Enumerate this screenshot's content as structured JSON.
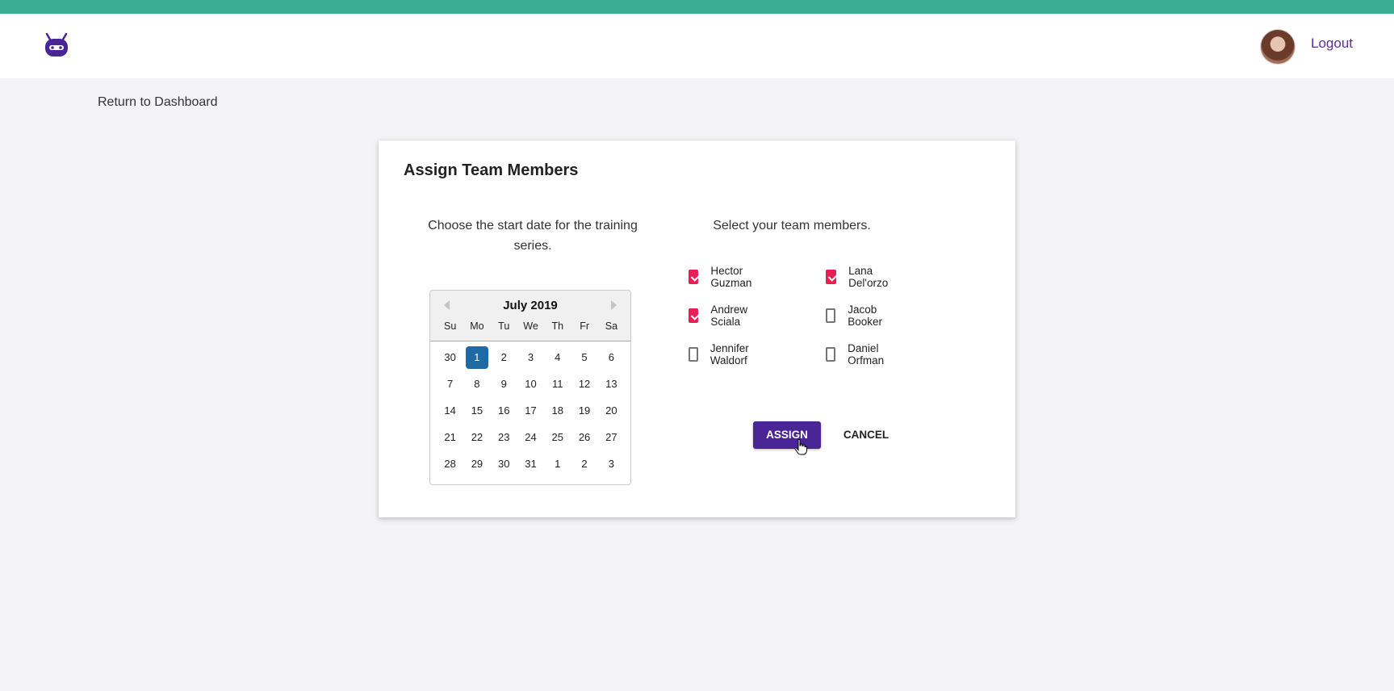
{
  "header": {
    "logo_icon": "robot-logo-icon",
    "avatar_icon": "user-avatar-icon",
    "logout_label": "Logout"
  },
  "nav": {
    "return_label": "Return to Dashboard"
  },
  "dialog": {
    "title": "Assign Team Members",
    "date_instruction": "Choose the start date for the training series.",
    "members_instruction": "Select your team members.",
    "assign_label": "ASSIGN",
    "cancel_label": "CANCEL"
  },
  "calendar": {
    "month_label": "July 2019",
    "prev_icon": "chevron-left-icon",
    "next_icon": "chevron-right-icon",
    "weekdays": [
      "Su",
      "Mo",
      "Tu",
      "We",
      "Th",
      "Fr",
      "Sa"
    ],
    "weeks": [
      [
        "30",
        "1",
        "2",
        "3",
        "4",
        "5",
        "6"
      ],
      [
        "7",
        "8",
        "9",
        "10",
        "11",
        "12",
        "13"
      ],
      [
        "14",
        "15",
        "16",
        "17",
        "18",
        "19",
        "20"
      ],
      [
        "21",
        "22",
        "23",
        "24",
        "25",
        "26",
        "27"
      ],
      [
        "28",
        "29",
        "30",
        "31",
        "1",
        "2",
        "3"
      ]
    ],
    "selected": "1"
  },
  "members": [
    {
      "name": "Hector Guzman",
      "checked": true
    },
    {
      "name": "Lana Del'orzo",
      "checked": true
    },
    {
      "name": "Andrew Sciala",
      "checked": true
    },
    {
      "name": "Jacob Booker",
      "checked": false
    },
    {
      "name": "Jennifer Waldorf",
      "checked": false
    },
    {
      "name": "Daniel Orfman",
      "checked": false
    }
  ],
  "colors": {
    "topbar": "#3aac94",
    "brand_purple": "#4a2596",
    "checkbox_checked": "#e91e55",
    "selected_day": "#1f6aa5",
    "logout_link": "#5b2d9c"
  }
}
